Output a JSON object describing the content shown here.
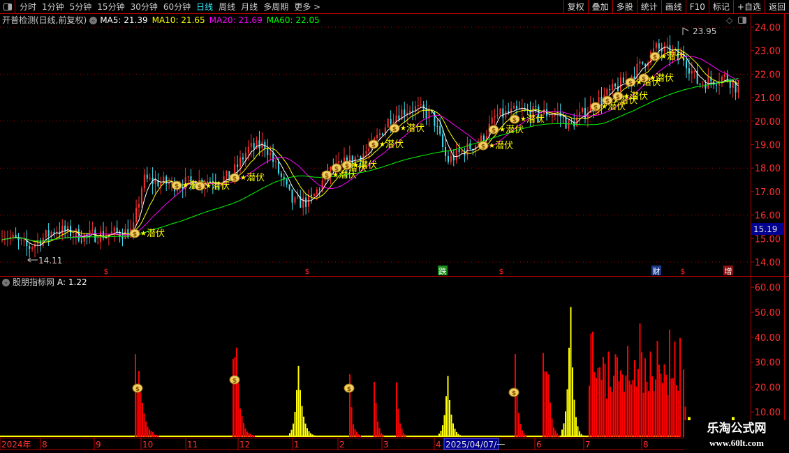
{
  "topbar": {
    "tabs": [
      {
        "label": "分时"
      },
      {
        "label": "1分钟"
      },
      {
        "label": "5分钟"
      },
      {
        "label": "15分钟"
      },
      {
        "label": "30分钟"
      },
      {
        "label": "60分钟"
      },
      {
        "label": "日线",
        "active": true
      },
      {
        "label": "周线"
      },
      {
        "label": "月线"
      },
      {
        "label": "多周期"
      },
      {
        "label": "更多 >"
      }
    ],
    "buttons": [
      {
        "label": "复权"
      },
      {
        "label": "叠加"
      },
      {
        "label": "多股"
      },
      {
        "label": "统计"
      },
      {
        "label": "画线"
      },
      {
        "label": "F10"
      },
      {
        "label": "标记"
      },
      {
        "label": "+自选"
      },
      {
        "label": "返回"
      }
    ]
  },
  "main": {
    "title": "开普检测(日线,前复权)",
    "ma": [
      {
        "label": "MA5: 21.39",
        "color": "#ffffff"
      },
      {
        "label": "MA10: 21.65",
        "color": "#ffff00"
      },
      {
        "label": "MA20: 21.69",
        "color": "#ff00ff"
      },
      {
        "label": "MA60: 22.05",
        "color": "#00ff00"
      }
    ],
    "high_label": "23.95",
    "low_label": "14.11",
    "current_price": "15.19",
    "y_ticks": [
      "24.00",
      "23.00",
      "22.00",
      "21.00",
      "20.00",
      "19.00",
      "18.00",
      "17.00",
      "16.00",
      "15.00",
      "14.00"
    ],
    "signal_label": "潜伏",
    "event_markers": [
      {
        "label": "$",
        "color": "#ff2020"
      },
      {
        "label": "$",
        "color": "#ff2020"
      },
      {
        "label": "跌",
        "color": "#1a8a1a"
      },
      {
        "label": "$",
        "color": "#ff2020"
      },
      {
        "label": "财",
        "color": "#1a3a8a"
      },
      {
        "label": "$",
        "color": "#ff2020"
      },
      {
        "label": "增",
        "color": "#8a1010"
      }
    ]
  },
  "indicator": {
    "title": "股朋指标网",
    "value": "A: 1.22",
    "y_ticks": [
      "60.00",
      "50.00",
      "40.00",
      "30.00",
      "20.00",
      "10.00"
    ]
  },
  "date_axis": {
    "labels": [
      "2024年",
      "8",
      "9",
      "10",
      "11",
      "12",
      "1",
      "2",
      "3",
      "4",
      "6",
      "7",
      "8"
    ],
    "cursor_date": "2025/04/07/一"
  },
  "watermark": {
    "name": "乐淘公式网",
    "url": "www.60lt.com"
  },
  "colors": {
    "up": "#ff3030",
    "down": "#40e0f0",
    "grid": "#b00000",
    "axis_text": "#ff3030"
  },
  "chart_data": {
    "type": "candlestick",
    "price_waypoints": [
      15.3,
      14.6,
      15.4,
      15.1,
      15.3,
      17.5,
      17.3,
      17.6,
      18.8,
      19.0,
      16.5,
      16.6,
      17.8,
      18.8,
      20.2,
      20.6,
      20.2,
      18.3,
      19.2,
      20.2,
      20.4,
      20.3,
      19.8,
      20.7,
      21.8,
      23.1,
      22.7,
      21.6,
      21.9,
      21.2
    ],
    "ylim": [
      14,
      24
    ],
    "indicator_ylim": [
      0,
      60
    ],
    "indicator_clusters": [
      {
        "peak": 34,
        "color": "red"
      },
      {
        "peak": 36,
        "color": "red"
      },
      {
        "peak": 31,
        "color": "yellow"
      },
      {
        "peak": 22,
        "color": "red"
      },
      {
        "peak": 23,
        "color": "red"
      },
      {
        "peak": 22,
        "color": "red"
      },
      {
        "peak": 27,
        "color": "yellow"
      },
      {
        "peak": 30,
        "color": "red"
      },
      {
        "peak": 35,
        "color": "red"
      },
      {
        "peak": 59,
        "color": "yellow"
      },
      {
        "peak": 40,
        "color": "red"
      },
      {
        "peak": 24,
        "color": "red"
      }
    ]
  }
}
